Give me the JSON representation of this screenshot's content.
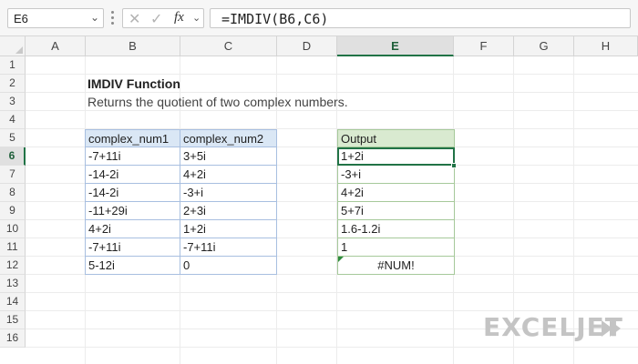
{
  "formula_bar": {
    "name_box": "E6",
    "formula": "=IMDIV(B6,C6)",
    "fx_label": "fx"
  },
  "columns": [
    "A",
    "B",
    "C",
    "D",
    "E",
    "F",
    "G",
    "H"
  ],
  "active_column": "E",
  "rows": [
    "1",
    "2",
    "3",
    "4",
    "5",
    "6",
    "7",
    "8",
    "9",
    "10",
    "11",
    "12",
    "13",
    "14",
    "15",
    "16"
  ],
  "active_row": "6",
  "sheet": {
    "title": "IMDIV Function",
    "subtitle": "Returns the quotient of two complex numbers.",
    "table": {
      "headers": [
        "complex_num1",
        "complex_num2"
      ],
      "rows": [
        [
          "-7+11i",
          "3+5i"
        ],
        [
          "-14-2i",
          "4+2i"
        ],
        [
          "-14-2i",
          "-3+i"
        ],
        [
          "-11+29i",
          "2+3i"
        ],
        [
          "4+2i",
          "1+2i"
        ],
        [
          "-7+11i",
          "-7+11i"
        ],
        [
          "5-12i",
          "0"
        ]
      ]
    },
    "output": {
      "header": "Output",
      "values": [
        "1+2i",
        "-3+i",
        "4+2i",
        "5+7i",
        "1.6-1.2i",
        "1",
        "#NUM!"
      ]
    }
  },
  "logo": "EXCELJET",
  "colors": {
    "selection": "#217346",
    "table_header": "#dae7f5",
    "output_header": "#d9ead0"
  }
}
